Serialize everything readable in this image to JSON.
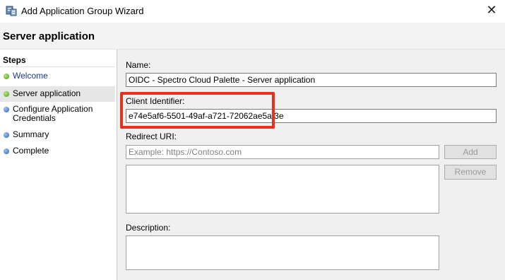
{
  "window": {
    "title": "Add Application Group Wizard"
  },
  "page": {
    "title": "Server application"
  },
  "steps": {
    "title": "Steps",
    "items": [
      {
        "label": "Welcome"
      },
      {
        "label": "Server application"
      },
      {
        "label": "Configure Application Credentials",
        "line1": "Configure Application",
        "line2": "Credentials"
      },
      {
        "label": "Summary"
      },
      {
        "label": "Complete"
      }
    ]
  },
  "form": {
    "name": {
      "label": "Name:",
      "value": "OIDC - Spectro Cloud Palette - Server application"
    },
    "client_identifier": {
      "label": "Client Identifier:",
      "value": "e74e5af6-5501-49af-a721-72062ae5af3e"
    },
    "redirect_uri": {
      "label": "Redirect URI:",
      "placeholder": "Example: https://Contoso.com",
      "add_label": "Add",
      "remove_label": "Remove"
    },
    "description": {
      "label": "Description:"
    }
  },
  "colors": {
    "highlight": "#e8321f",
    "step_done": "#3f9d1b",
    "step_pending": "#2b64b8"
  }
}
